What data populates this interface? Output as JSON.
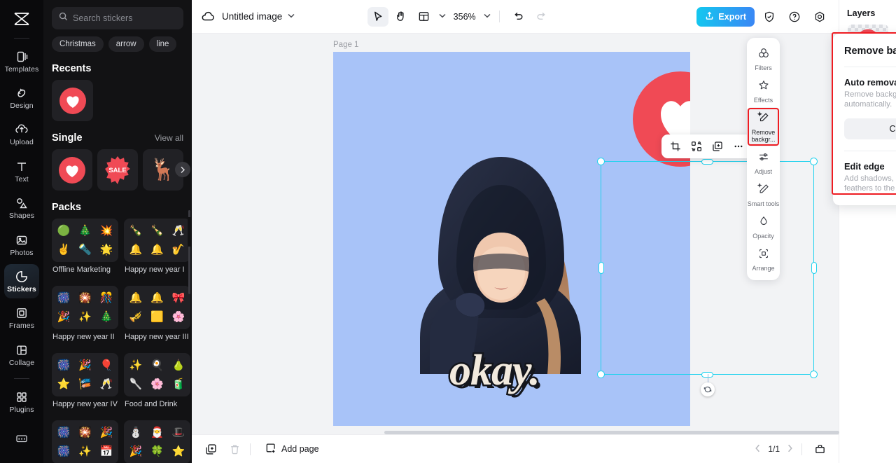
{
  "left_nav": {
    "brand": "capcut-logo",
    "items": [
      {
        "label": "Templates",
        "icon": "templates-icon",
        "active": false
      },
      {
        "label": "Design",
        "icon": "design-icon",
        "active": false
      },
      {
        "label": "Upload",
        "icon": "upload-icon",
        "active": false
      },
      {
        "label": "Text",
        "icon": "text-icon",
        "active": false
      },
      {
        "label": "Shapes",
        "icon": "shapes-icon",
        "active": false
      },
      {
        "label": "Photos",
        "icon": "photos-icon",
        "active": false
      },
      {
        "label": "Stickers",
        "icon": "stickers-icon",
        "active": true
      },
      {
        "label": "Frames",
        "icon": "frames-icon",
        "active": false
      },
      {
        "label": "Collage",
        "icon": "collage-icon",
        "active": false
      },
      {
        "label": "Plugins",
        "icon": "plugins-icon",
        "active": false
      }
    ],
    "bottom_item": {
      "label": "",
      "icon": "keyboard-icon"
    }
  },
  "sticker_panel": {
    "search_placeholder": "Search stickers",
    "search_value": "",
    "chips": [
      "Christmas",
      "arrow",
      "line"
    ],
    "recents": {
      "title": "Recents",
      "items": [
        "heart-sticker"
      ]
    },
    "single": {
      "title": "Single",
      "view_all": "View all",
      "items": [
        "heart-sticker",
        "sale-badge-sticker",
        "reindeer-sticker"
      ],
      "next_arrow": "chevron-right-icon"
    },
    "packs": {
      "title": "Packs",
      "items": [
        {
          "name": "Offline Marketing",
          "glyphs": [
            "🟢",
            "🎄",
            "💥",
            "✌",
            "🔦",
            "🌟"
          ]
        },
        {
          "name": "Happy new year I",
          "glyphs": [
            "🍾",
            "🍾",
            "🥂",
            "🔔",
            "🔔",
            "🎷"
          ]
        },
        {
          "name": "Happy new year II",
          "glyphs": [
            "🎆",
            "🎇",
            "🎊",
            "🎉",
            "✨",
            "🎄"
          ]
        },
        {
          "name": "Happy new year III",
          "glyphs": [
            "🔔",
            "🔔",
            "🎀",
            "🎺",
            "🟨",
            "🌸"
          ]
        },
        {
          "name": "Happy new year IV",
          "glyphs": [
            "🎆",
            "🎉",
            "🎈",
            "⭐",
            "🎏",
            "🥂"
          ]
        },
        {
          "name": "Food and Drink",
          "glyphs": [
            "✨",
            "🍳",
            "🍐",
            "🥄",
            "🌸",
            "🧃"
          ]
        },
        {
          "name": "",
          "glyphs": [
            "🎆",
            "🎇",
            "🎉",
            "🎆",
            "✨",
            "📅"
          ]
        },
        {
          "name": "",
          "glyphs": [
            "⛄",
            "🎅",
            "🎩",
            "🎉",
            "🍀",
            "⭐"
          ]
        }
      ]
    }
  },
  "topbar": {
    "cloud_icon": "cloud-sync-icon",
    "doc_title": "Untitled image",
    "title_caret": "chevron-down-icon",
    "tools": [
      {
        "name": "select-tool",
        "icon": "cursor-icon",
        "selected": true
      },
      {
        "name": "hand-tool",
        "icon": "hand-icon",
        "selected": false
      },
      {
        "name": "layout-tool",
        "icon": "layout-icon",
        "selected": false
      }
    ],
    "layout_caret": "chevron-down-icon",
    "zoom": "356%",
    "zoom_caret": "chevron-down-icon",
    "undo": "undo-icon",
    "redo": "redo-icon",
    "export_label": "Export",
    "export_icon": "upload-share-icon",
    "shield_icon": "shield-check-icon",
    "help_icon": "help-circle-icon",
    "settings_icon": "gear-icon"
  },
  "canvas": {
    "page_label": "Page 1",
    "background_color": "#a8c3f8",
    "okay_text": "okay.",
    "object_toolbar": [
      {
        "name": "crop-button",
        "icon": "crop-icon"
      },
      {
        "name": "replace-button",
        "icon": "replace-icon"
      },
      {
        "name": "duplicate-button",
        "icon": "duplicate-icon"
      },
      {
        "name": "more-options-button",
        "icon": "ellipsis-icon"
      }
    ],
    "rotate_handle": "rotate-icon"
  },
  "tool_rail": {
    "items": [
      {
        "label": "Filters",
        "icon": "filters-icon",
        "active": false
      },
      {
        "label": "Effects",
        "icon": "effects-icon",
        "active": false
      },
      {
        "label": "Remove backgr...",
        "icon": "remove-background-icon",
        "active": true
      },
      {
        "label": "Adjust",
        "icon": "adjust-icon",
        "active": false
      },
      {
        "label": "Smart tools",
        "icon": "smart-tools-icon",
        "active": false
      },
      {
        "label": "Opacity",
        "icon": "opacity-icon",
        "active": false
      },
      {
        "label": "Arrange",
        "icon": "arrange-icon",
        "active": false
      }
    ]
  },
  "remove_background_panel": {
    "title": "Remove background",
    "close_icon": "close-icon",
    "auto_removal": {
      "title": "Auto removal",
      "subtitle": "Remove backgrounds automatically.",
      "toggle_on": true,
      "toggle_color": "#12cfe8"
    },
    "customize_label": "Customize",
    "edit_edge": {
      "title": "Edit edge",
      "subtitle": "Add shadows, strokes, glow, and feathers to the edges of an image.",
      "chevron": "chevron-right-icon"
    },
    "highlight_color": "#ee1c22"
  },
  "layers_panel": {
    "title": "Layers",
    "items": [
      {
        "name": "heart-sticker-layer",
        "type": "sticker",
        "selected": false
      },
      {
        "name": "okay-text-layer",
        "type": "text",
        "selected": false
      },
      {
        "name": "photo-layer",
        "type": "image",
        "selected": true
      },
      {
        "name": "background-layer",
        "type": "background",
        "selected": false,
        "badge": "mask-icon"
      }
    ]
  },
  "bottombar": {
    "duplicate_page_icon": "duplicate-page-icon",
    "delete_page_icon": "trash-icon",
    "add_page_label": "Add page",
    "add_page_icon": "add-page-icon",
    "prev_icon": "chevron-left-icon",
    "page_indicator": "1/1",
    "next_icon": "chevron-right-icon",
    "grid_view_icon": "page-view-icon"
  }
}
